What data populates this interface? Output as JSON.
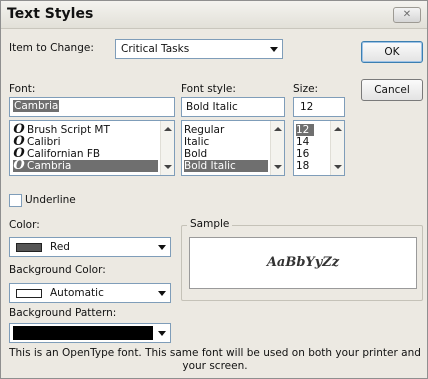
{
  "dialog": {
    "title": "Text Styles",
    "close_icon": "close-icon"
  },
  "item_to_change": {
    "label": "Item to Change:",
    "value": "Critical Tasks"
  },
  "buttons": {
    "ok": "OK",
    "cancel": "Cancel"
  },
  "font": {
    "label": "Font:",
    "value": "Cambria",
    "items": [
      "Brush Script MT",
      "Calibri",
      "Californian FB",
      "Cambria"
    ],
    "selected_index": 3,
    "item_icon": "opentype-font-icon"
  },
  "font_style": {
    "label": "Font style:",
    "value": "Bold Italic",
    "items": [
      "Regular",
      "Italic",
      "Bold",
      "Bold Italic"
    ],
    "selected_index": 3
  },
  "size": {
    "label": "Size:",
    "value": "12",
    "items": [
      "12",
      "14",
      "16",
      "18"
    ],
    "selected_index": 0
  },
  "underline": {
    "label": "Underline",
    "checked": false
  },
  "color": {
    "label": "Color:",
    "value": "Red",
    "swatch": "#555555"
  },
  "background_color": {
    "label": "Background Color:",
    "value": "Automatic",
    "swatch": "#ffffff"
  },
  "background_pattern": {
    "label": "Background Pattern:",
    "swatch": "#000000"
  },
  "sample": {
    "label": "Sample",
    "text": "AaBbYyZz"
  },
  "footer": {
    "line1": "This is an OpenType font. This same font will be used on both your printer and",
    "line2": "your screen."
  }
}
